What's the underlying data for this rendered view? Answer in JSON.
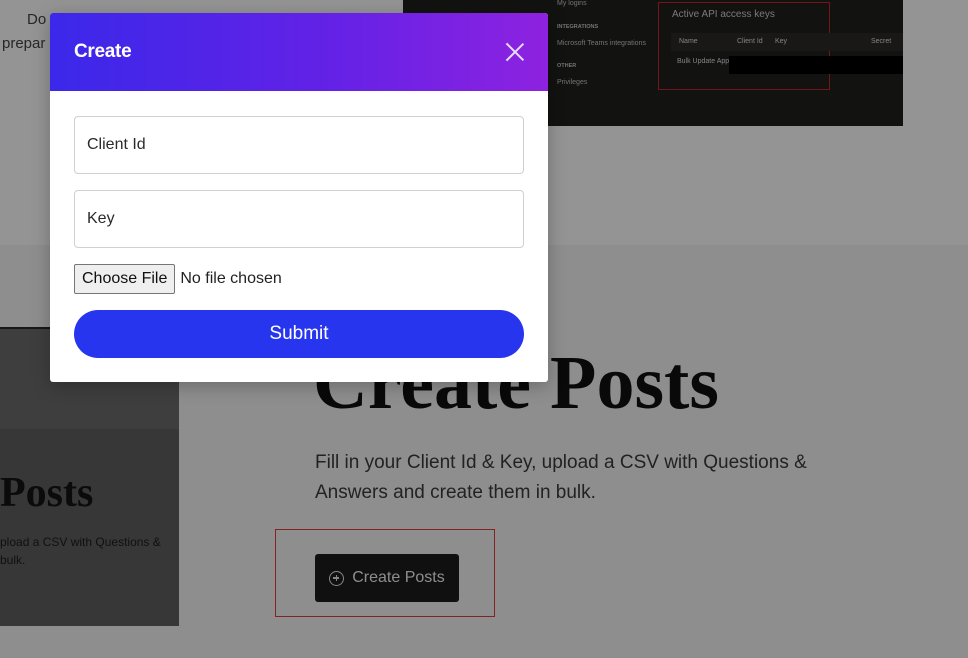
{
  "background": {
    "top_text": {
      "line1": "Do",
      "line2": "prepar"
    },
    "ms_panel": {
      "side_items": [
        "My logins",
        "INTEGRATIONS",
        "Microsoft Teams integrations",
        "OTHER",
        "Privileges"
      ],
      "keys_title": "Active API access keys",
      "columns": {
        "name": "Name",
        "client_id": "Client Id",
        "key": "Key",
        "secret": "Secret"
      },
      "row_name": "Bulk Update App"
    },
    "left_card": {
      "title": "Posts",
      "desc_line1": "pload a CSV with Questions &",
      "desc_line2": "bulk."
    },
    "main": {
      "heading": "Create Posts",
      "description": "Fill in your Client Id & Key, upload a CSV with Questions & Answers and create them in bulk.",
      "cta_label": "Create Posts",
      "cta_icon": "plus-circle-icon"
    }
  },
  "modal": {
    "title": "Create",
    "close_icon": "close-icon",
    "client_id_placeholder": "Client Id",
    "key_placeholder": "Key",
    "choose_file_label": "Choose File",
    "no_file_text": "No file chosen",
    "submit_label": "Submit"
  },
  "colors": {
    "header_gradient_start": "#3b28ea",
    "header_gradient_end": "#8e22e0",
    "submit_blue": "#2735ef",
    "overlay": "rgba(0,0,0,0.42)"
  }
}
